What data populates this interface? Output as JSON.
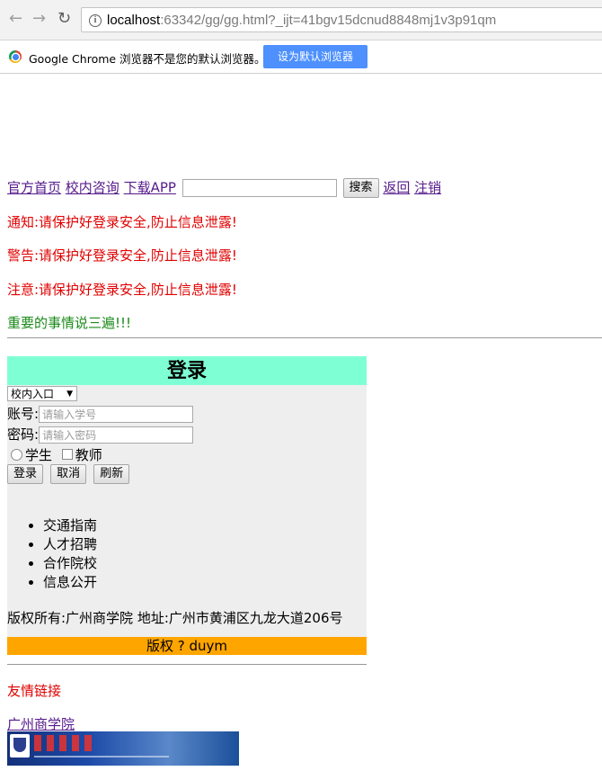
{
  "browser": {
    "url_host": "localhost",
    "url_rest": ":63342/gg/gg.html?_ijt=41bgv15dcnud8848mj1v3p91qm",
    "infobar_message": "Google Chrome 浏览器不是您的默认浏览器。",
    "infobar_button": "设为默认浏览器"
  },
  "topnav": {
    "link_home": "官方首页",
    "link_consult": "校内咨询",
    "link_app": "下载APP",
    "search_button": "搜索",
    "link_back": "返回",
    "link_logout": "注销"
  },
  "notices": [
    "通知:请保护好登录安全,防止信息泄露!",
    "警告:请保护好登录安全,防止信息泄露!",
    "注意:请保护好登录安全,防止信息泄露!",
    "重要的事情说三遍!!!"
  ],
  "login": {
    "title": "登录",
    "entry_select": "校内入口",
    "account_label": "账号:",
    "account_placeholder": "请输入学号",
    "password_label": "密码:",
    "password_placeholder": "请输入密码",
    "role_student": "学生",
    "role_teacher": "教师",
    "btn_login": "登录",
    "btn_cancel": "取消",
    "btn_refresh": "刷新",
    "links": [
      "交通指南",
      "人才招聘",
      "合作院校",
      "信息公开"
    ],
    "copyright": "版权所有:广州商学院 地址:广州市黄浦区九龙大道206号",
    "footer": "版权 ? duym"
  },
  "friends": {
    "title": "友情链接",
    "link": "广州商学院"
  },
  "colors": {
    "notice_red": "#e00000",
    "notice_green": "#1a8a1a",
    "login_title_bg": "#7fffd4",
    "login_bg": "#eeeeee",
    "footer_bg": "#ffa500",
    "link_visited": "#551a8b"
  }
}
